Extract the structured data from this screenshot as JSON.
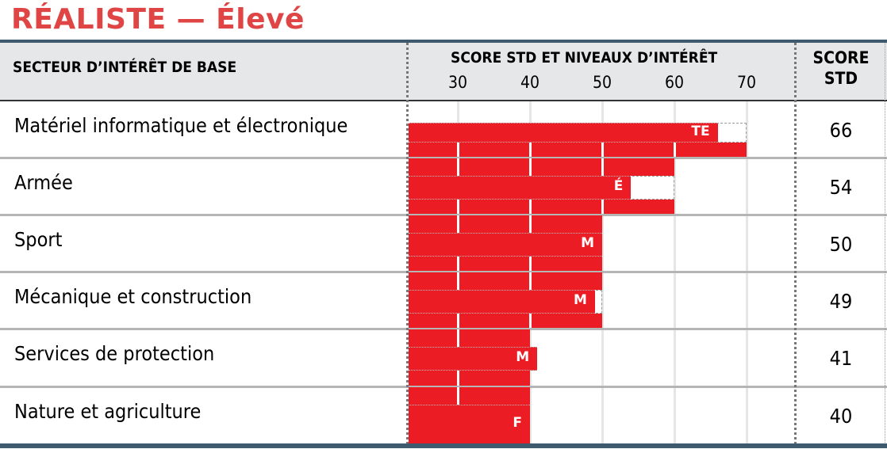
{
  "title": "RÉALISTE — Élevé",
  "header": {
    "sector": "SECTEUR D’INTÉRÊT DE BASE",
    "chart": "SCORE STD ET NIVEAUX D’INTÉRÊT",
    "score_line1": "SCORE",
    "score_line2": "STD"
  },
  "colors": {
    "bar": "#ec1c24",
    "title": "#e04545",
    "border": "#3d5a6e"
  },
  "chart_data": {
    "type": "bar",
    "orientation": "horizontal",
    "ticks": [
      "30",
      "40",
      "50",
      "60",
      "70"
    ],
    "xlim": [
      23.2,
      76
    ],
    "rows": [
      {
        "label": "Matériel informatique et électronique",
        "score": 66,
        "level": "TE",
        "level_max": 70,
        "band_above": null,
        "band_below": 70
      },
      {
        "label": "Armée",
        "score": 54,
        "level": "É",
        "level_max": 60,
        "band_above": 60,
        "band_below": 60
      },
      {
        "label": "Sport",
        "score": 50,
        "level": "M",
        "level_max": 50,
        "band_above": 50,
        "band_below": 50
      },
      {
        "label": "Mécanique et construction",
        "score": 49,
        "level": "M",
        "level_max": 50,
        "band_above": 50,
        "band_below": 50
      },
      {
        "label": "Services de protection",
        "score": 41,
        "level": "M",
        "level_max": 40,
        "band_above": 40,
        "band_below": 40
      },
      {
        "label": "Nature et agriculture",
        "score": 40,
        "level": "F",
        "level_max": 40,
        "band_above": 40,
        "band_below": null
      }
    ]
  }
}
